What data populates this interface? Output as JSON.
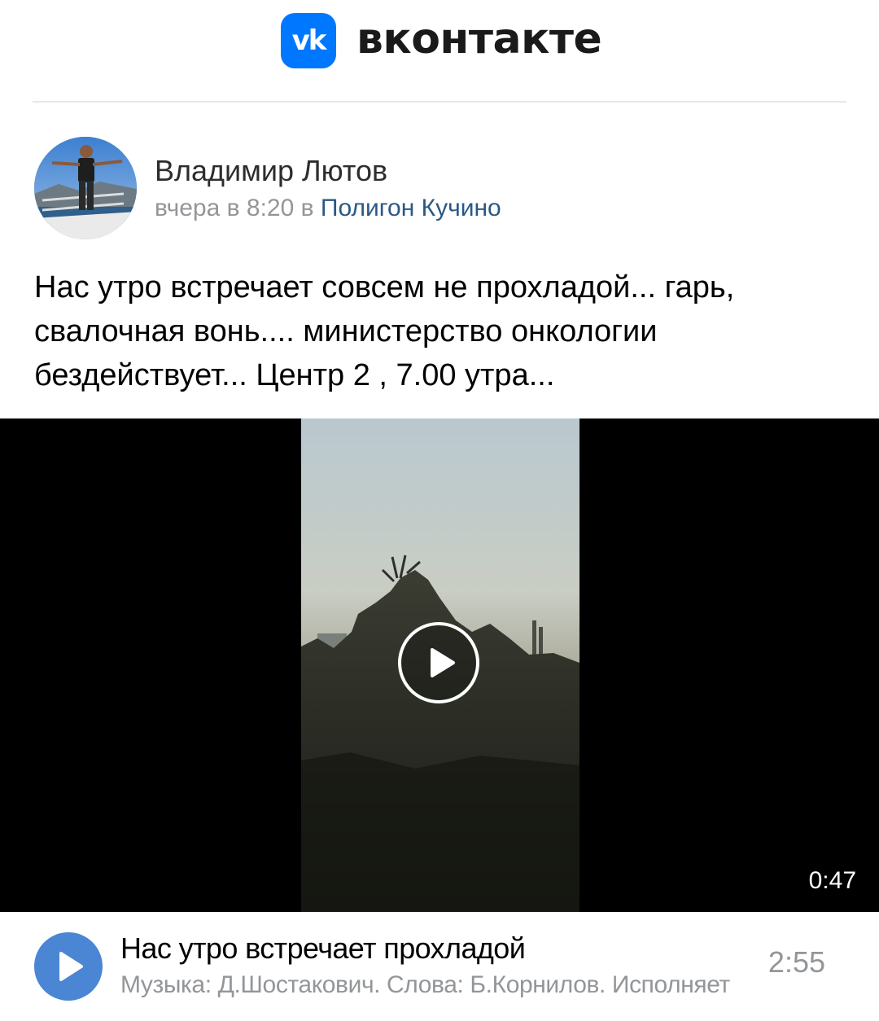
{
  "brand": {
    "logo_icon": "vk-logo-icon",
    "logo_text": "vk",
    "name": "вконтакте",
    "accent": "#0077ff"
  },
  "post": {
    "author": "Владимир Лютов",
    "time_prefix": "вчера в 8:20 в ",
    "place": "Полигон Кучино",
    "text": "Нас утро встречает совсем не прохладой... гарь,\nсвалочная вонь.... министерство онкологии\nбездействует... Центр 2 , 7.00 утра..."
  },
  "video": {
    "duration": "0:47",
    "play_icon": "play-icon"
  },
  "audio": {
    "title": "Нас утро встречает прохладой",
    "artist": "Музыка: Д.Шостакович. Слова: Б.Корнилов. Исполняет",
    "duration": "2:55",
    "play_icon": "play-icon",
    "button_color": "#4a86d4"
  },
  "colors": {
    "link": "#2a5885",
    "muted": "#939699",
    "divider": "#e7e8ec"
  }
}
